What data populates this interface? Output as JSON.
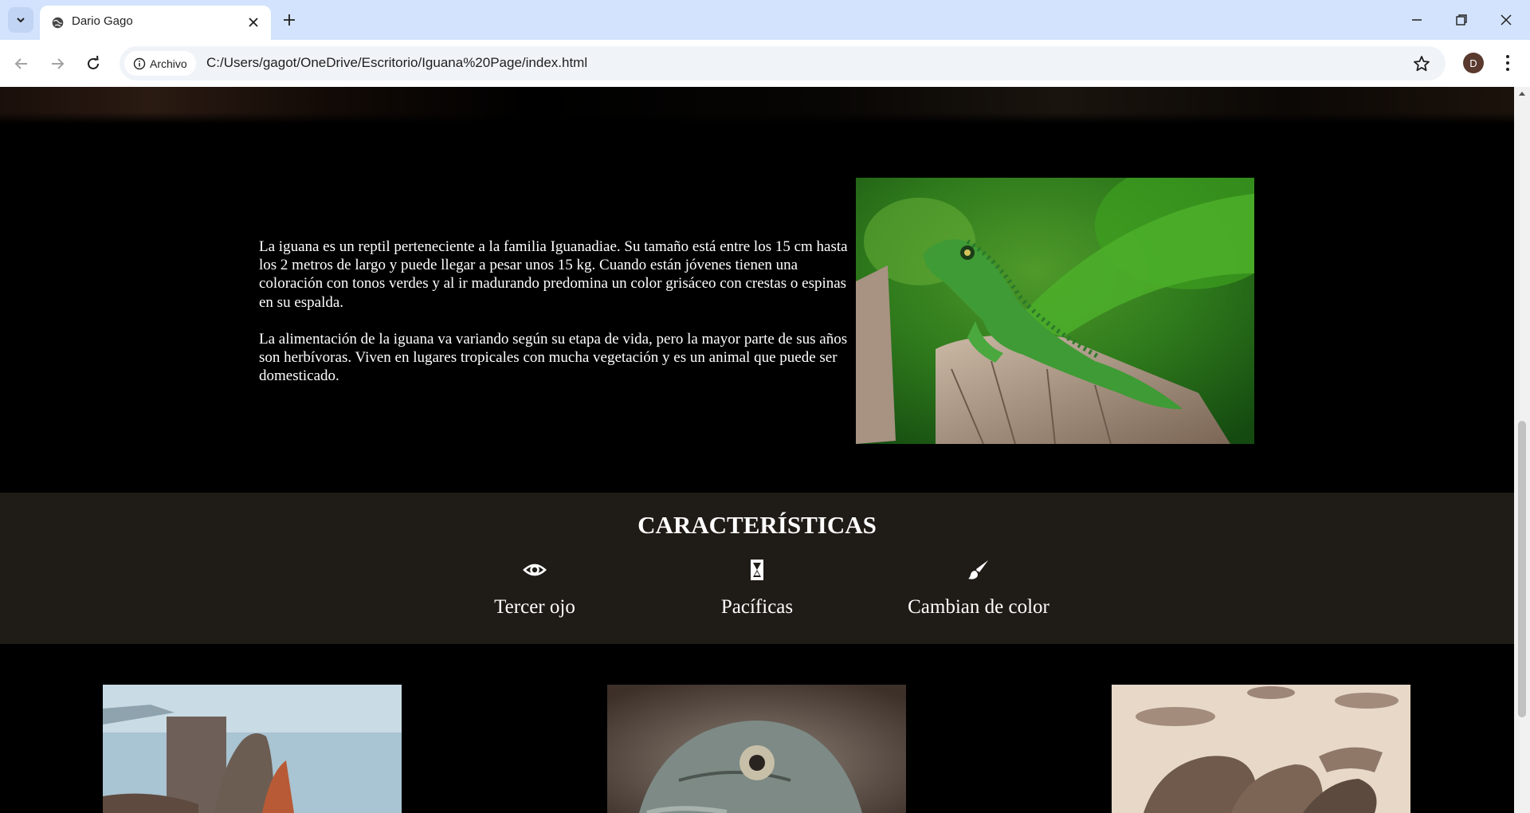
{
  "browser": {
    "tab_title": "Dario Gago",
    "site_chip_label": "Archivo",
    "url": "C:/Users/gagot/OneDrive/Escritorio/Iguana%20Page/index.html",
    "profile_initial": "D"
  },
  "intro": {
    "paragraph_1": "La iguana es un reptil perteneciente a la familia Iguanadiae. Su tamaño está entre los 15 cm hasta los 2 metros de largo y puede llegar a pesar unos 15 kg. Cuando están jóvenes tienen una coloración con tonos verdes y al ir madurando predomina un color grisáceo con crestas o espinas en su espalda.",
    "paragraph_2": "La alimentación de la iguana va variando según su etapa de vida, pero la mayor parte de sus años son herbívoras. Viven en lugares tropicales con mucha vegetación y es un animal que puede ser domesticado."
  },
  "features": {
    "title": "CARACTERÍSTICAS",
    "items": [
      {
        "label": "Tercer ojo",
        "icon": "eye-icon"
      },
      {
        "label": "Pacíficas",
        "icon": "hourglass-icon"
      },
      {
        "label": "Cambian de color",
        "icon": "paintbrush-icon"
      }
    ]
  },
  "colors": {
    "tabbar_bg": "#d3e3fd",
    "page_bg": "#000000",
    "features_bg": "#1f1b16",
    "text": "#ffffff"
  }
}
